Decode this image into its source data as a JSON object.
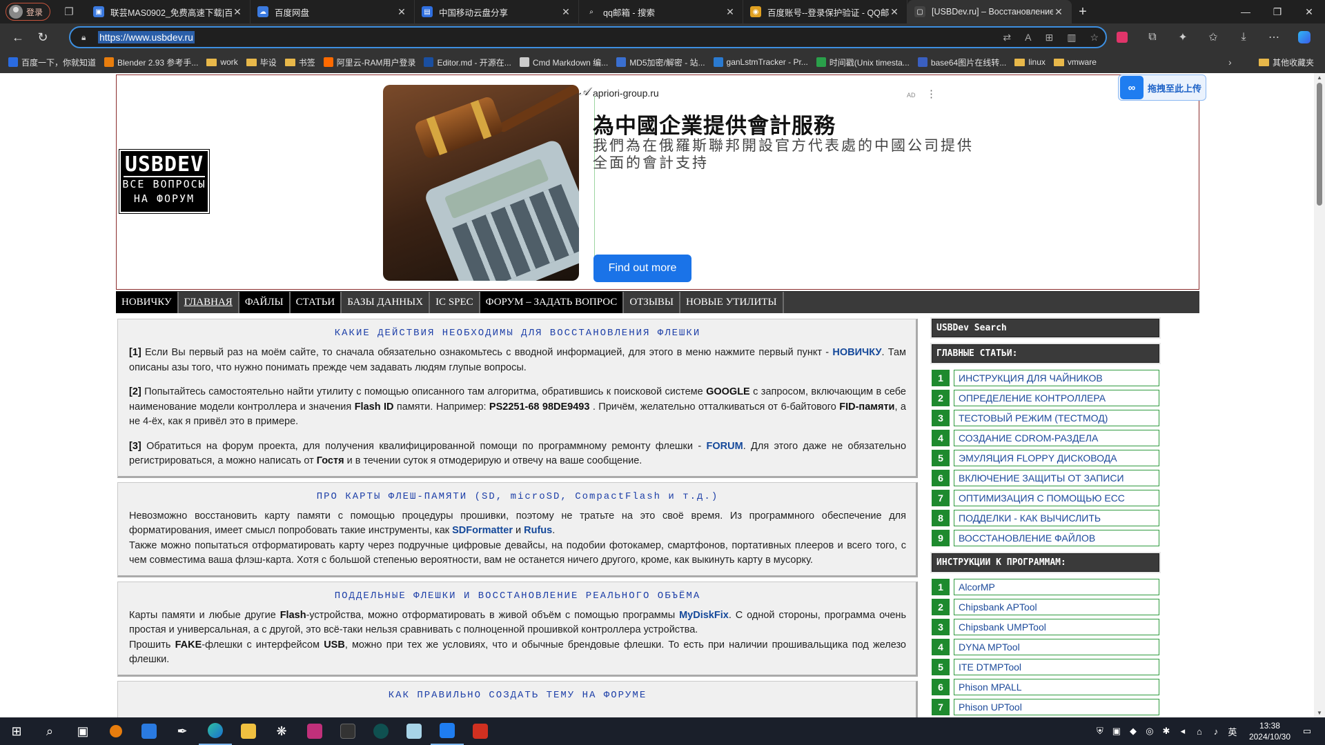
{
  "browser": {
    "profile_label": "登录",
    "tabs": [
      {
        "title": "联芸MAS0902_免费高速下载|百度",
        "fav": "#3b7ae0",
        "fav_glyph": "▣"
      },
      {
        "title": "百度网盘",
        "fav": "#3b7ae0",
        "fav_glyph": "☁"
      },
      {
        "title": "中国移动云盘分享",
        "fav": "#2f6fe0",
        "fav_glyph": "▤"
      },
      {
        "title": "qq邮箱 - 搜索",
        "fav": "#202020",
        "fav_glyph": "⌕"
      },
      {
        "title": "百度账号--登录保护验证 - QQ邮箱",
        "fav": "#e0a020",
        "fav_glyph": "◉"
      },
      {
        "title": "[USBDev.ru] – Восстановление ф",
        "fav": "#444",
        "fav_glyph": "▢"
      }
    ],
    "url": "https://www.usbdev.ru",
    "bookmarks": [
      {
        "label": "百度一下，你就知道",
        "color": "#2a6be0"
      },
      {
        "label": "Blender 2.93 参考手...",
        "color": "#e87d0d"
      },
      {
        "label": "work",
        "folder": true
      },
      {
        "label": "毕设",
        "folder": true
      },
      {
        "label": "书签",
        "folder": true
      },
      {
        "label": "阿里云-RAM用户登录",
        "color": "#ff6a00"
      },
      {
        "label": "Editor.md - 开源在...",
        "color": "#1a4fa0"
      },
      {
        "label": "Cmd Markdown 编...",
        "color": "#cccccc"
      },
      {
        "label": "MD5加密/解密 - 站...",
        "color": "#3a6fd0"
      },
      {
        "label": "ganLstmTracker - Pr...",
        "color": "#2a7ad0"
      },
      {
        "label": "时间戳(Unix timesta...",
        "color": "#2aa04a"
      },
      {
        "label": "base64图片在线转...",
        "color": "#3a5fc0"
      },
      {
        "label": "linux",
        "folder": true
      },
      {
        "label": "vmware",
        "folder": true
      }
    ],
    "other_bookmarks": "其他收藏夹"
  },
  "upload_button": "拖拽至此上传",
  "logo": {
    "line1": "USBDEV",
    "line2": "ВСЕ ВОПРОСЫ",
    "line3": "НА ФОРУМ"
  },
  "ad": {
    "domain": "apriori-group.ru",
    "tag": "AD",
    "headline": "為中國企業提供會計服務",
    "subline": "我們為在俄羅斯聯邦開設官方代表處的中國公司提供全面的會計支持",
    "cta": "Find out more"
  },
  "menu": [
    "НОВИЧКУ",
    "ГЛАВНАЯ",
    "ФАЙЛЫ",
    "СТАТЬИ",
    "БАЗЫ ДАННЫХ",
    "IC SPEC",
    "ФОРУМ – ЗАДАТЬ ВОПРОС",
    "ОТЗЫВЫ",
    "НОВЫЕ УТИЛИТЫ"
  ],
  "sections": [
    {
      "title": "КАКИЕ ДЕЙСТВИЯ НЕОБХОДИМЫ ДЛЯ ВОССТАНОВЛЕНИЯ ФЛЕШКИ",
      "p1a": "[1]",
      "p1b": " Если Вы первый раз на моём сайте, то сначала обязательно ознакомьтесь с вводной информацией, для этого в меню нажмите первый пункт - ",
      "p1c": "НОВИЧКУ",
      "p1d": ". Там описаны азы того, что нужно понимать прежде чем задавать людям глупые вопросы.",
      "p2a": "[2]",
      "p2b": " Попытайтесь самостоятельно найти утилиту с помощью описанного там алгоритма, обратившись к поисковой системе ",
      "p2c": "GOOGLE",
      "p2d": " с запросом, включающим в себе наименование модели контроллера и значения ",
      "p2e": "Flash ID",
      "p2f": " памяти. Например: ",
      "p2g": "PS2251-68 98DE9493",
      "p2h": " . Причём, желательно отталкиваться от 6-байтового ",
      "p2i": "FID-памяти",
      "p2j": ", а не 4-ёх, как я привёл это в примере.",
      "p3a": "[3]",
      "p3b": " Обратиться на форум проекта, для получения квалифицированной помощи по программному ремонту флешки - ",
      "p3c": "FORUM",
      "p3d": ". Для этого даже не обязательно регистрироваться, а можно написать от ",
      "p3e": "Гостя",
      "p3f": " и в течении суток я отмодерирую и отвечу на ваше сообщение."
    },
    {
      "title": "ПРО КАРТЫ ФЛЕШ-ПАМЯТИ (SD, microSD, CompactFlash и т.д.)",
      "p1a": "Невозможно восстановить карту памяти с помощью процедуры прошивки, поэтому не тратьте на это своё время. Из программного обеспечение для форматирования, имеет смысл попробовать такие инструменты, как ",
      "p1b": "SDFormatter",
      "p1c": " и ",
      "p1d": "Rufus",
      "p1e": ".",
      "p2": "Также можно попытаться отформатировать карту через подручные цифровые девайсы, на подобии фотокамер, смартфонов, портативных плееров и всего того, с чем совместима ваша флэш-карта. Хотя с большой степенью вероятности, вам не останется ничего другого, кроме, как выкинуть карту в мусорку."
    },
    {
      "title": "ПОДДЕЛЬНЫЕ ФЛЕШКИ И ВОССТАНОВЛЕНИЕ РЕАЛЬНОГО ОБЪЁМА",
      "p1a": "Карты памяти и любые другие ",
      "p1b": "Flash",
      "p1c": "-устройства, можно отформатировать в живой объём с помощью программы ",
      "p1d": "MyDiskFix",
      "p1e": ". С одной стороны, программа очень простая и универсальная, а с другой, это всё-таки нельзя сравнивать с полноценной прошивкой контроллера устройства.",
      "p2a": "Прошить ",
      "p2b": "FAKE",
      "p2c": "-флешки с интерфейсом ",
      "p2d": "USB",
      "p2e": ", можно при тех же условиях, что и обычные брендовые флешки. То есть при наличии прошивальщика под железо флешки."
    },
    {
      "title": "КАК ПРАВИЛЬНО СОЗДАТЬ ТЕМУ НА ФОРУМЕ"
    }
  ],
  "sidebar": {
    "search": "USBDev Search",
    "articles_header": "ГЛАВНЫЕ СТАТЬИ:",
    "articles": [
      {
        "n": "1",
        "t": "ИНСТРУКЦИЯ ДЛЯ ЧАЙНИКОВ"
      },
      {
        "n": "2",
        "t": "ОПРЕДЕЛЕНИЕ КОНТРОЛЛЕРА"
      },
      {
        "n": "3",
        "t": "ТЕСТОВЫЙ РЕЖИМ (ТЕСТМОД)"
      },
      {
        "n": "4",
        "t": "СОЗДАНИЕ CDROM-РАЗДЕЛА"
      },
      {
        "n": "5",
        "t": "ЭМУЛЯЦИЯ FLOPPY ДИСКОВОДА"
      },
      {
        "n": "6",
        "t": "ВКЛЮЧЕНИЕ ЗАЩИТЫ ОТ ЗАПИСИ"
      },
      {
        "n": "7",
        "t": "ОПТИМИЗАЦИЯ С ПОМОЩЬЮ ECC"
      },
      {
        "n": "8",
        "t": "ПОДДЕЛКИ - КАК ВЫЧИСЛИТЬ"
      },
      {
        "n": "9",
        "t": "ВОССТАНОВЛЕНИЕ ФАЙЛОВ"
      }
    ],
    "programs_header": "ИНСТРУКЦИИ К ПРОГРАММАМ:",
    "programs": [
      {
        "n": "1",
        "t": "AlcorMP"
      },
      {
        "n": "2",
        "t": "Chipsbank APTool"
      },
      {
        "n": "3",
        "t": "Chipsbank UMPTool"
      },
      {
        "n": "4",
        "t": "DYNA MPTool"
      },
      {
        "n": "5",
        "t": "ITE DTMPTool"
      },
      {
        "n": "6",
        "t": "Phison MPALL"
      },
      {
        "n": "7",
        "t": "Phison UPTool"
      }
    ]
  },
  "taskbar": {
    "time": "13:38",
    "date": "2024/10/30",
    "ime": "英"
  }
}
